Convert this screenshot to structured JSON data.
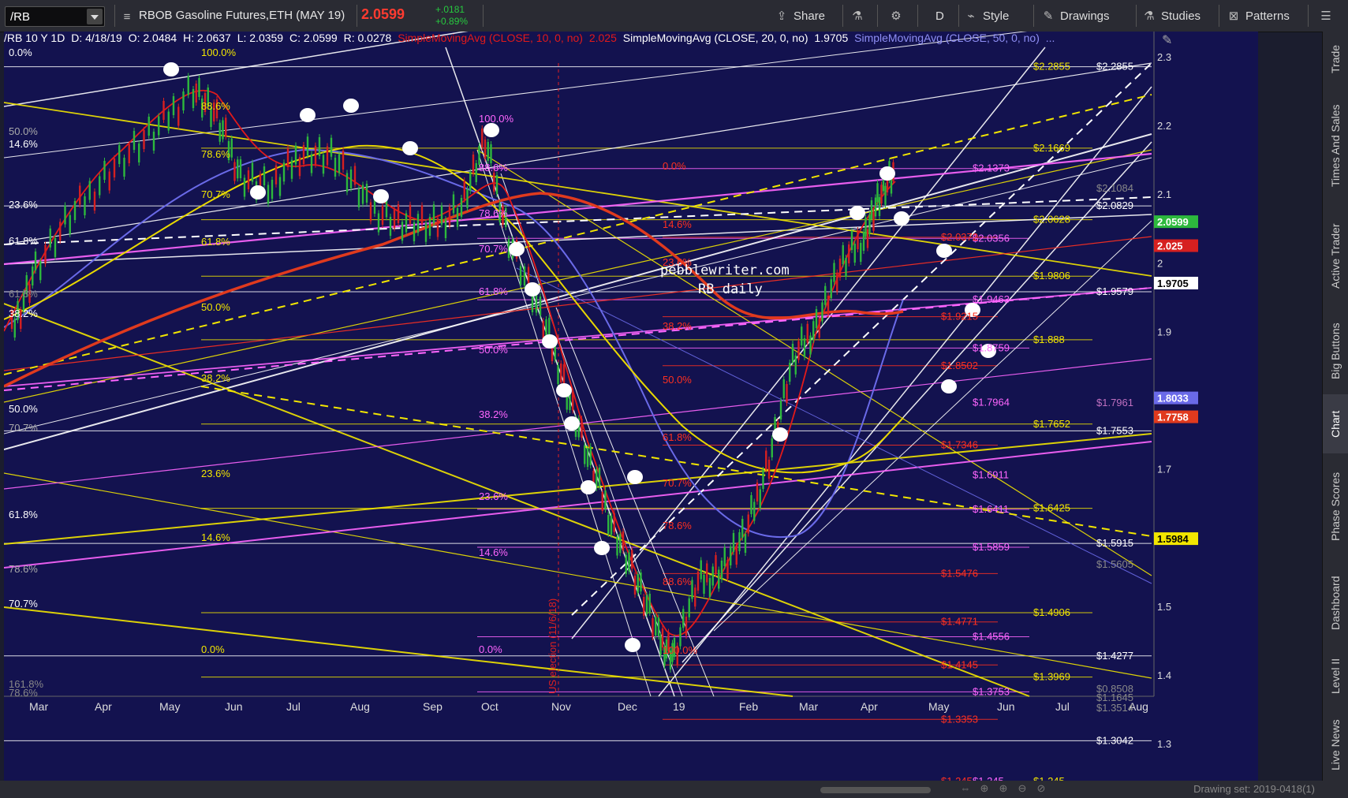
{
  "toolbar": {
    "symbol": "/RB",
    "instrument": "RBOB Gasoline Futures,ETH (MAY 19)",
    "last_price": "2.0599",
    "change": "+.0181",
    "change_pct": "+0.89%",
    "share_label": "Share",
    "timeframe_label": "D",
    "style_label": "Style",
    "drawings_label": "Drawings",
    "studies_label": "Studies",
    "patterns_label": "Patterns"
  },
  "infobar": {
    "symbol": "/RB 10 Y 1D",
    "date": "D: 4/18/19",
    "open": "O: 2.0484",
    "high": "H: 2.0637",
    "low": "L: 2.0359",
    "close": "C: 2.0599",
    "range": "R: 0.0278",
    "sma10_label": "SimpleMovingAvg (CLOSE, 10, 0, no)",
    "sma10_value": "2.025",
    "sma20_label": "SimpleMovingAvg (CLOSE, 20, 0, no)",
    "sma20_value": "1.9705",
    "sma50_label": "SimpleMovingAvg (CLOSE, 50, 0, no)",
    "sma50_value": "..."
  },
  "sidebar_tabs": [
    "Trade",
    "Times And Sales",
    "Active Trader",
    "Big Buttons",
    "Chart",
    "Phase Scores",
    "Dashboard",
    "Level II",
    "Live News"
  ],
  "selected_tab": "Chart",
  "axis": {
    "price_ticks": [
      "2.3",
      "2.2",
      "2.1",
      "2",
      "1.9",
      "1.7",
      "1.6",
      "1.5",
      "1.4",
      "1.3"
    ],
    "time_ticks": [
      "Mar",
      "Apr",
      "May",
      "Jun",
      "Jul",
      "Aug",
      "Sep",
      "Oct",
      "Nov",
      "Dec",
      "19",
      "Feb",
      "Mar",
      "Apr",
      "May",
      "Jun",
      "Jul",
      "Aug"
    ]
  },
  "price_badges": [
    {
      "text": "2.0599",
      "color": "#2db83d"
    },
    {
      "text": "2.025",
      "color": "#d62020"
    },
    {
      "text": "1.9705",
      "color": "#ffffff"
    },
    {
      "text": "1.8033",
      "color": "#6a6ae8"
    },
    {
      "text": "1.7758",
      "color": "#e03a1e"
    },
    {
      "text": "1.5984",
      "color": "#f2e600"
    }
  ],
  "white_fib_labels": [
    "$2.2855",
    "$2.0829",
    "$1.9579",
    "$1.7553",
    "$1.5915",
    "$1.4277",
    "$1.3042",
    "$2.1084",
    "$1.5605",
    "$1.3514",
    "$0.8508",
    "$1.1645"
  ],
  "yellow_fib_labels": [
    "$2.2855",
    "$2.1669",
    "$2.0628",
    "$1.9806",
    "$1.888",
    "$1.7652",
    "$1.6425",
    "$1.4906",
    "$1.3969",
    "$1.245"
  ],
  "magenta_fib_labels": [
    "$2.1373",
    "$2.0356",
    "$1.9463",
    "$1.8759",
    "$1.7964",
    "$1.6911",
    "$1.6411",
    "$1.5859",
    "$1.4556",
    "$1.3753",
    "$1.245",
    "$1.7961"
  ],
  "red_fib_labels": [
    "$2.0372",
    "$1.9215",
    "$1.8502",
    "$1.7346",
    "$1.5476",
    "$1.4771",
    "$1.4145",
    "$1.3353",
    "$1.245"
  ],
  "left_pct_labels": [
    "0.0%",
    "50.0%",
    "14.6%",
    "23.6%",
    "61.8%",
    "38.2%",
    "50.0%",
    "70.7%",
    "61.8%",
    "78.6%",
    "70.7%",
    "161.8%",
    "78.6%",
    "61.8%"
  ],
  "mid_pct_labels": [
    "100.0%",
    "88.6%",
    "78.6%",
    "70.7%",
    "61.8%",
    "50.0%",
    "38.2%",
    "23.6%",
    "14.6%",
    "0.0%"
  ],
  "oct_pct_labels": [
    "100.0%",
    "88.6%",
    "78.6%",
    "70.7%",
    "61.8%",
    "50.0%",
    "38.2%",
    "23.6%",
    "14.6%",
    "0.0%"
  ],
  "red_pct_labels": [
    "0.0%",
    "14.6%",
    "23.6%",
    "38.2%",
    "50.0%",
    "61.8%",
    "70.7%",
    "78.6%",
    "88.6%",
    "100.0%"
  ],
  "watermark": {
    "line1": "pebblewriter.com",
    "line2": "RB daily"
  },
  "annotation": "US election (11/6/18)",
  "bottom": {
    "drawing_set": "Drawing set: 2019-0418(1)"
  },
  "colors": {
    "background": "#13124f",
    "gridline": "#23226a",
    "accent_up": "#2db83d",
    "accent_down": "#d62020"
  }
}
